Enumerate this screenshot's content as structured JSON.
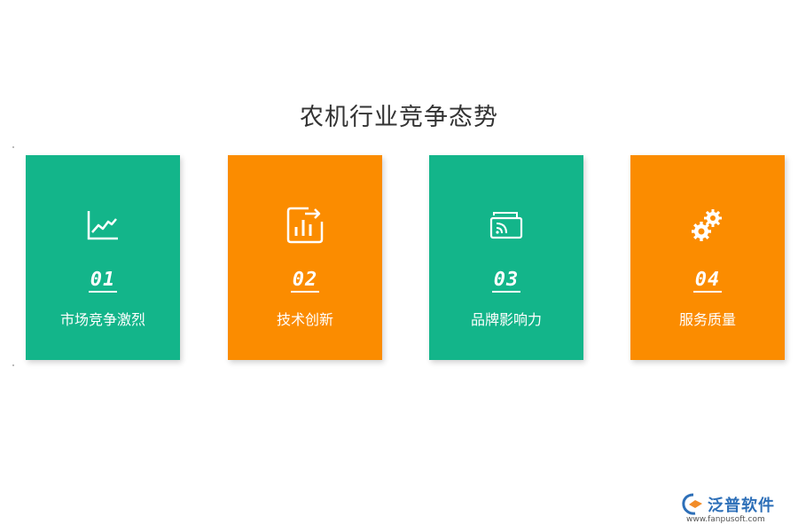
{
  "title": "农机行业竞争态势",
  "colors": {
    "green": "#13b58a",
    "orange": "#fb8c00",
    "brand_blue": "#2d6fb8",
    "brand_orange": "#f28c28"
  },
  "cards": [
    {
      "number": "01",
      "label": "市场竞争激烈",
      "icon": "line-chart-icon",
      "color": "#13b58a"
    },
    {
      "number": "02",
      "label": "技术创新",
      "icon": "bar-chart-export-icon",
      "color": "#fb8c00"
    },
    {
      "number": "03",
      "label": "品牌影响力",
      "icon": "cast-screen-icon",
      "color": "#13b58a"
    },
    {
      "number": "04",
      "label": "服务质量",
      "icon": "gears-icon",
      "color": "#fb8c00"
    }
  ],
  "logo": {
    "name": "泛普软件",
    "url": "www.fanpusoft.com"
  }
}
